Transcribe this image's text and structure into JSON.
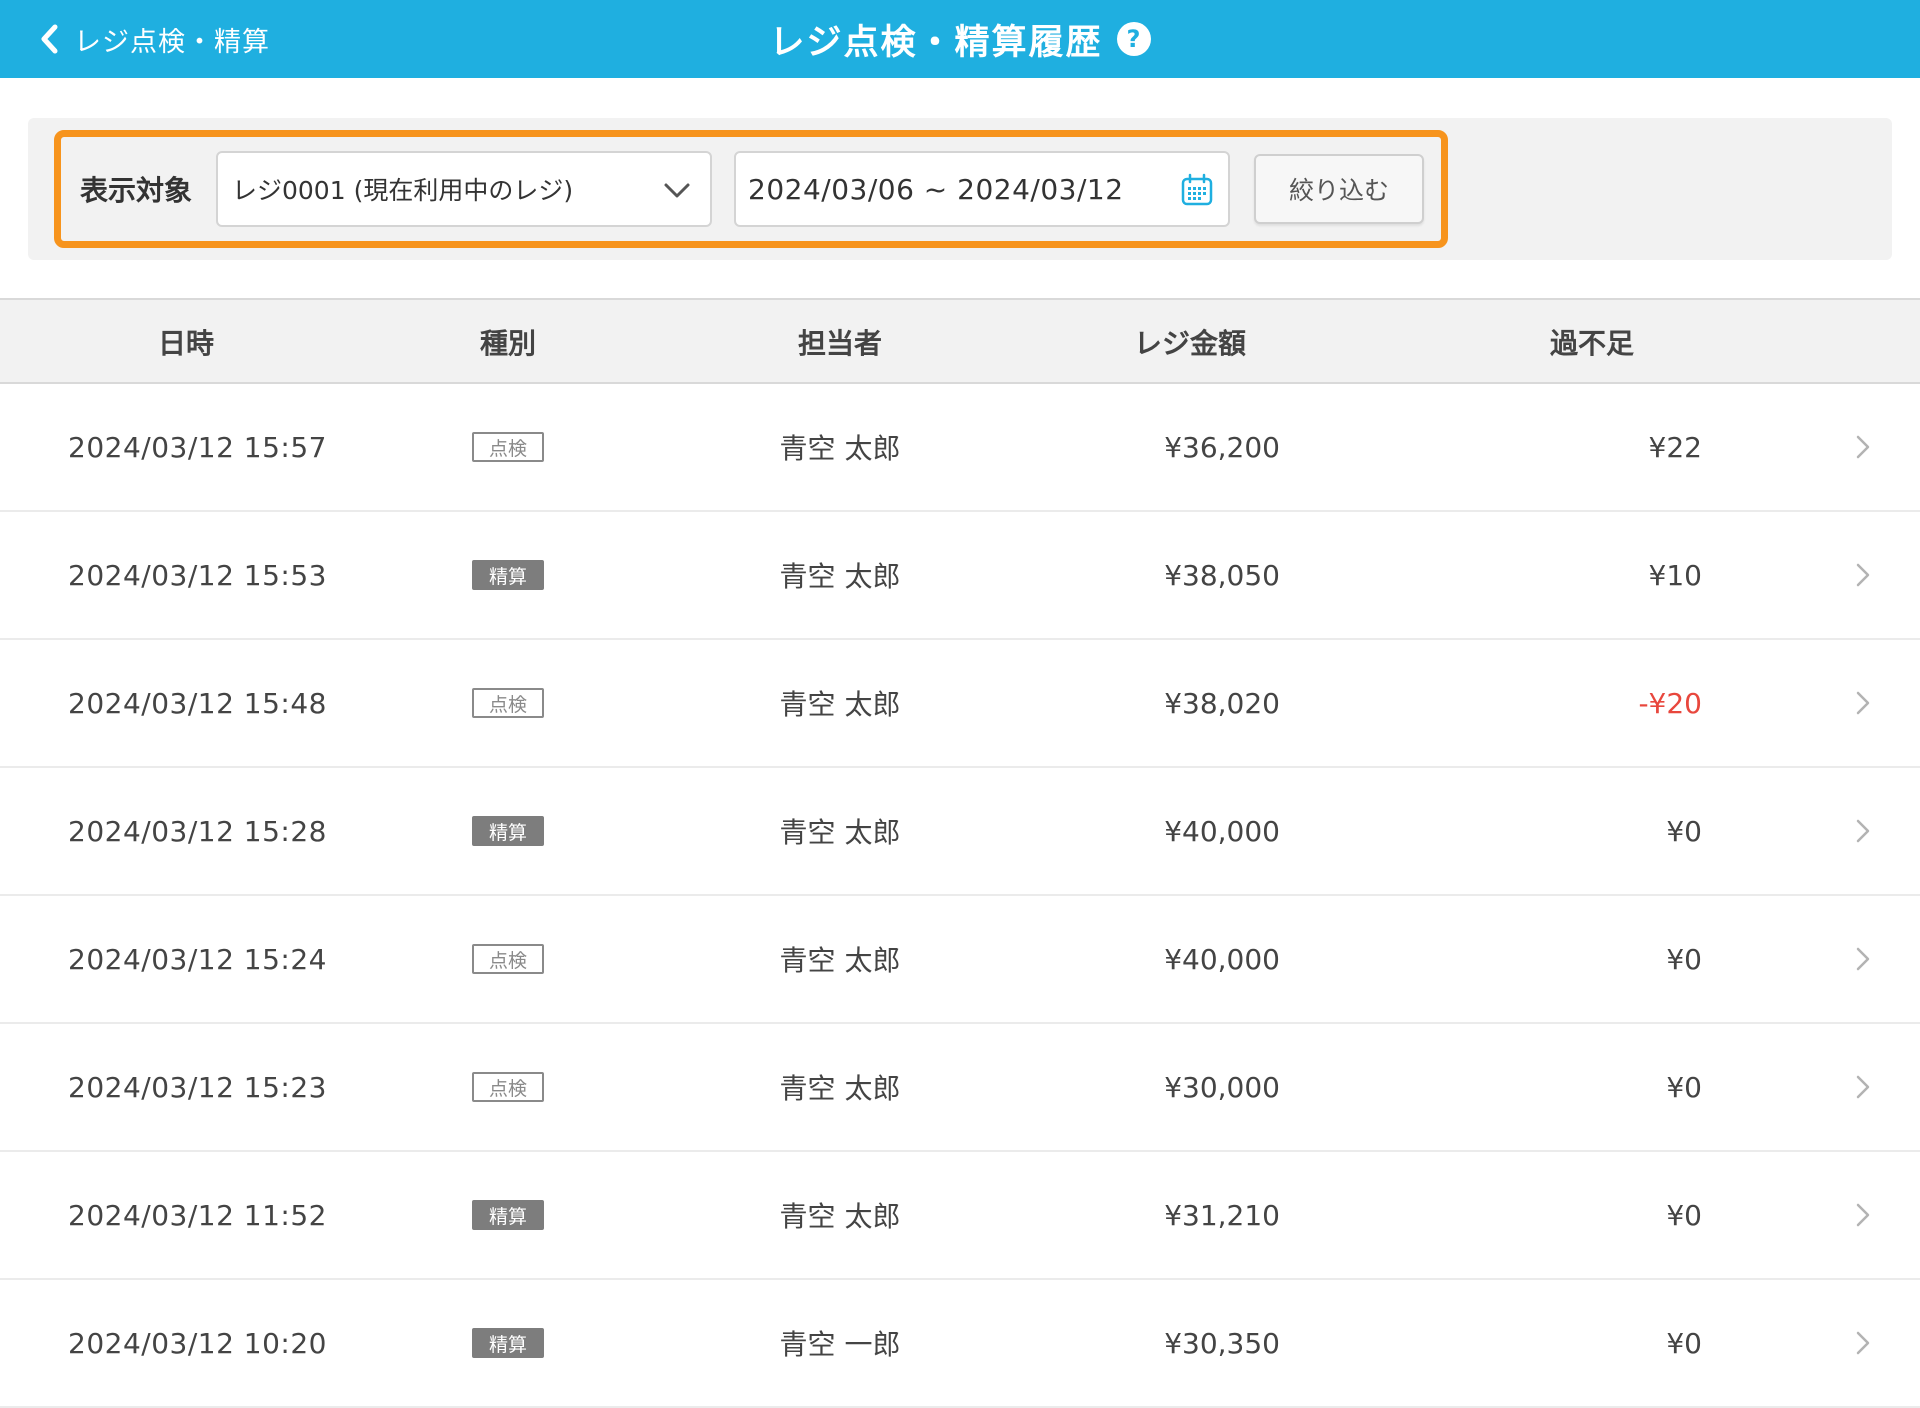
{
  "header": {
    "back_label": "レジ点検・精算",
    "title": "レジ点検・精算履歴",
    "help_glyph": "?",
    "background_color": "#1fafe0"
  },
  "filter": {
    "label": "表示対象",
    "register_select_value": "レジ0001 (現在利用中のレジ)",
    "date_range_value": "2024/03/06 ~ 2024/03/12",
    "apply_button_label": "絞り込む",
    "highlight_color": "#f7941d"
  },
  "table": {
    "columns": [
      "日時",
      "種別",
      "担当者",
      "レジ金額",
      "過不足"
    ],
    "rows": [
      {
        "datetime": "2024/03/12 15:57",
        "type": "点検",
        "type_style": "outline",
        "staff": "青空 太郎",
        "amount": "¥36,200",
        "diff": "¥22",
        "diff_negative": false
      },
      {
        "datetime": "2024/03/12 15:53",
        "type": "精算",
        "type_style": "filled",
        "staff": "青空 太郎",
        "amount": "¥38,050",
        "diff": "¥10",
        "diff_negative": false
      },
      {
        "datetime": "2024/03/12 15:48",
        "type": "点検",
        "type_style": "outline",
        "staff": "青空 太郎",
        "amount": "¥38,020",
        "diff": "-¥20",
        "diff_negative": true
      },
      {
        "datetime": "2024/03/12 15:28",
        "type": "精算",
        "type_style": "filled",
        "staff": "青空 太郎",
        "amount": "¥40,000",
        "diff": "¥0",
        "diff_negative": false
      },
      {
        "datetime": "2024/03/12 15:24",
        "type": "点検",
        "type_style": "outline",
        "staff": "青空 太郎",
        "amount": "¥40,000",
        "diff": "¥0",
        "diff_negative": false
      },
      {
        "datetime": "2024/03/12 15:23",
        "type": "点検",
        "type_style": "outline",
        "staff": "青空 太郎",
        "amount": "¥30,000",
        "diff": "¥0",
        "diff_negative": false
      },
      {
        "datetime": "2024/03/12 11:52",
        "type": "精算",
        "type_style": "filled",
        "staff": "青空 太郎",
        "amount": "¥31,210",
        "diff": "¥0",
        "diff_negative": false
      },
      {
        "datetime": "2024/03/12 10:20",
        "type": "精算",
        "type_style": "filled",
        "staff": "青空 一郎",
        "amount": "¥30,350",
        "diff": "¥0",
        "diff_negative": false
      }
    ],
    "negative_color": "#e8473d"
  },
  "icons": {
    "back": "chevron-left-icon",
    "help": "question-circle-icon",
    "select": "chevron-down-icon",
    "date": "calendar-icon",
    "row": "chevron-right-icon"
  }
}
